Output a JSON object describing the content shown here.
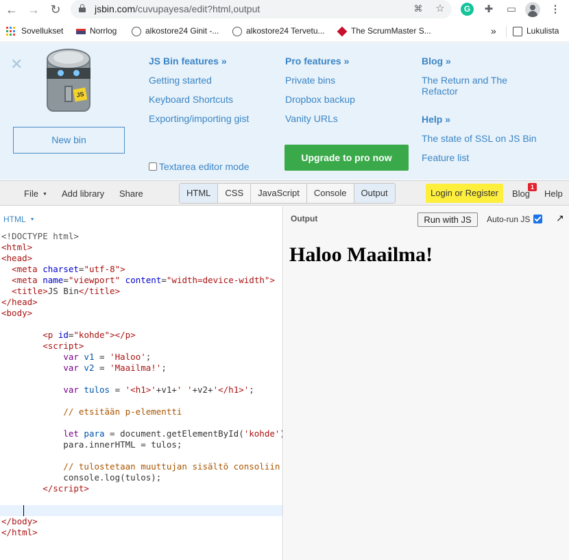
{
  "browser": {
    "url_host": "jsbin.com",
    "url_path": "/cuvupayesa/edit?html,output",
    "bookmarks": [
      {
        "label": "Sovellukset"
      },
      {
        "label": "Norrlog"
      },
      {
        "label": "alkostore24 Ginit -..."
      },
      {
        "label": "alkostore24 Tervetu..."
      },
      {
        "label": "The ScrumMaster S..."
      }
    ],
    "more_bookmarks": "»",
    "reading_list": "Lukulista"
  },
  "panel": {
    "new_bin": "New bin",
    "columns": {
      "features": {
        "heading": "JS Bin features »",
        "links": [
          "Getting started",
          "Keyboard Shortcuts",
          "Exporting/importing gist"
        ]
      },
      "pro": {
        "heading": "Pro features »",
        "links": [
          "Private bins",
          "Dropbox backup",
          "Vanity URLs"
        ]
      },
      "blog": {
        "heading": "Blog »",
        "link_line1": "The Return and The",
        "link_line2": "Refactor"
      },
      "help": {
        "heading": "Help »",
        "links": [
          "The state of SSL on JS Bin",
          "Feature list"
        ]
      }
    },
    "textarea_mode": "Textarea editor mode",
    "upgrade": "Upgrade to pro now"
  },
  "toolbar": {
    "file": "File",
    "add_library": "Add library",
    "share": "Share",
    "tabs": [
      "HTML",
      "CSS",
      "JavaScript",
      "Console",
      "Output"
    ],
    "active_tabs": [
      "HTML",
      "Output"
    ],
    "login": "Login or Register",
    "blog": "Blog",
    "blog_badge": "1",
    "help": "Help"
  },
  "editor": {
    "language": "HTML"
  },
  "output": {
    "label": "Output",
    "run_button": "Run with JS",
    "autorun_label": "Auto-run JS",
    "autorun_checked": true,
    "heading": "Haloo Maailma!"
  },
  "colors": {
    "panel_bg": "#e8f2fa",
    "link_blue": "#3a85c6",
    "upgrade_green": "#3aa94a",
    "login_yellow": "#ffef3d",
    "badge_red": "#e2222f"
  }
}
